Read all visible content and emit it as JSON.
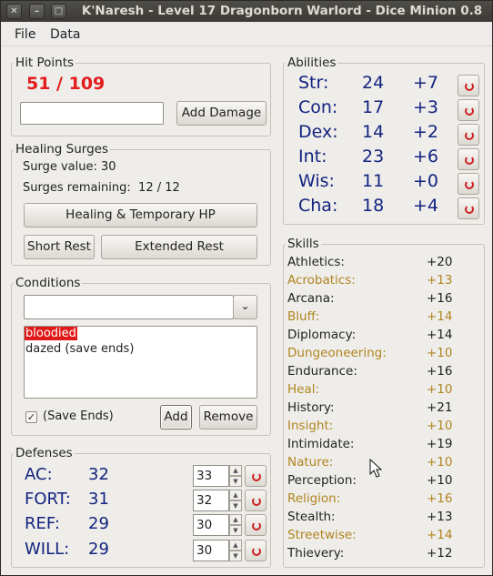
{
  "window": {
    "title": "K'Naresh - Level 17 Dragonborn Warlord - Dice Minion 0.8"
  },
  "menu": [
    "File",
    "Data"
  ],
  "hitpoints": {
    "label": "Hit Points",
    "value": "51 / 109",
    "damage_input": "",
    "add_damage": "Add Damage"
  },
  "surges": {
    "label": "Healing Surges",
    "surge_value": "Surge value: 30",
    "remaining": "Surges remaining:  12 / 12",
    "healing_button": "Healing & Temporary HP",
    "short_rest": "Short Rest",
    "extended_rest": "Extended Rest"
  },
  "conditions": {
    "label": "Conditions",
    "combo_value": "",
    "items": [
      "bloodied",
      "dazed (save ends)"
    ],
    "selected": 0,
    "save_ends_label": "(Save Ends)",
    "save_ends_checked": true,
    "add": "Add",
    "remove": "Remove"
  },
  "defenses": {
    "label": "Defenses",
    "items": [
      {
        "name": "AC:",
        "value": "32",
        "edit": "33"
      },
      {
        "name": "FORT:",
        "value": "31",
        "edit": "32"
      },
      {
        "name": "REF:",
        "value": "29",
        "edit": "30"
      },
      {
        "name": "WILL:",
        "value": "29",
        "edit": "30"
      }
    ]
  },
  "abilities": {
    "label": "Abilities",
    "items": [
      {
        "name": "Str:",
        "score": "24",
        "mod": "+7"
      },
      {
        "name": "Con:",
        "score": "17",
        "mod": "+3"
      },
      {
        "name": "Dex:",
        "score": "14",
        "mod": "+2"
      },
      {
        "name": "Int:",
        "score": "23",
        "mod": "+6"
      },
      {
        "name": "Wis:",
        "score": "11",
        "mod": "+0"
      },
      {
        "name": "Cha:",
        "score": "18",
        "mod": "+4"
      }
    ]
  },
  "skills": {
    "label": "Skills",
    "items": [
      {
        "name": "Athletics:",
        "value": "+20",
        "trained": true
      },
      {
        "name": "Acrobatics:",
        "value": "+13",
        "trained": false
      },
      {
        "name": "Arcana:",
        "value": "+16",
        "trained": true
      },
      {
        "name": "Bluff:",
        "value": "+14",
        "trained": false
      },
      {
        "name": "Diplomacy:",
        "value": "+14",
        "trained": true
      },
      {
        "name": "Dungeoneering:",
        "value": "+10",
        "trained": false
      },
      {
        "name": "Endurance:",
        "value": "+16",
        "trained": true
      },
      {
        "name": "Heal:",
        "value": "+10",
        "trained": false
      },
      {
        "name": "History:",
        "value": "+21",
        "trained": true
      },
      {
        "name": "Insight:",
        "value": "+10",
        "trained": false
      },
      {
        "name": "Intimidate:",
        "value": "+19",
        "trained": true
      },
      {
        "name": "Nature:",
        "value": "+10",
        "trained": false
      },
      {
        "name": "Perception:",
        "value": "+10",
        "trained": true
      },
      {
        "name": "Religion:",
        "value": "+16",
        "trained": false
      },
      {
        "name": "Stealth:",
        "value": "+13",
        "trained": true
      },
      {
        "name": "Streetwise:",
        "value": "+14",
        "trained": false
      },
      {
        "name": "Thievery:",
        "value": "+12",
        "trained": true
      }
    ]
  },
  "colors": {
    "hp": "#e31b1b",
    "stat_blue": "#13237e",
    "skill_gold": "#b1841f",
    "selection": "#e01818"
  }
}
